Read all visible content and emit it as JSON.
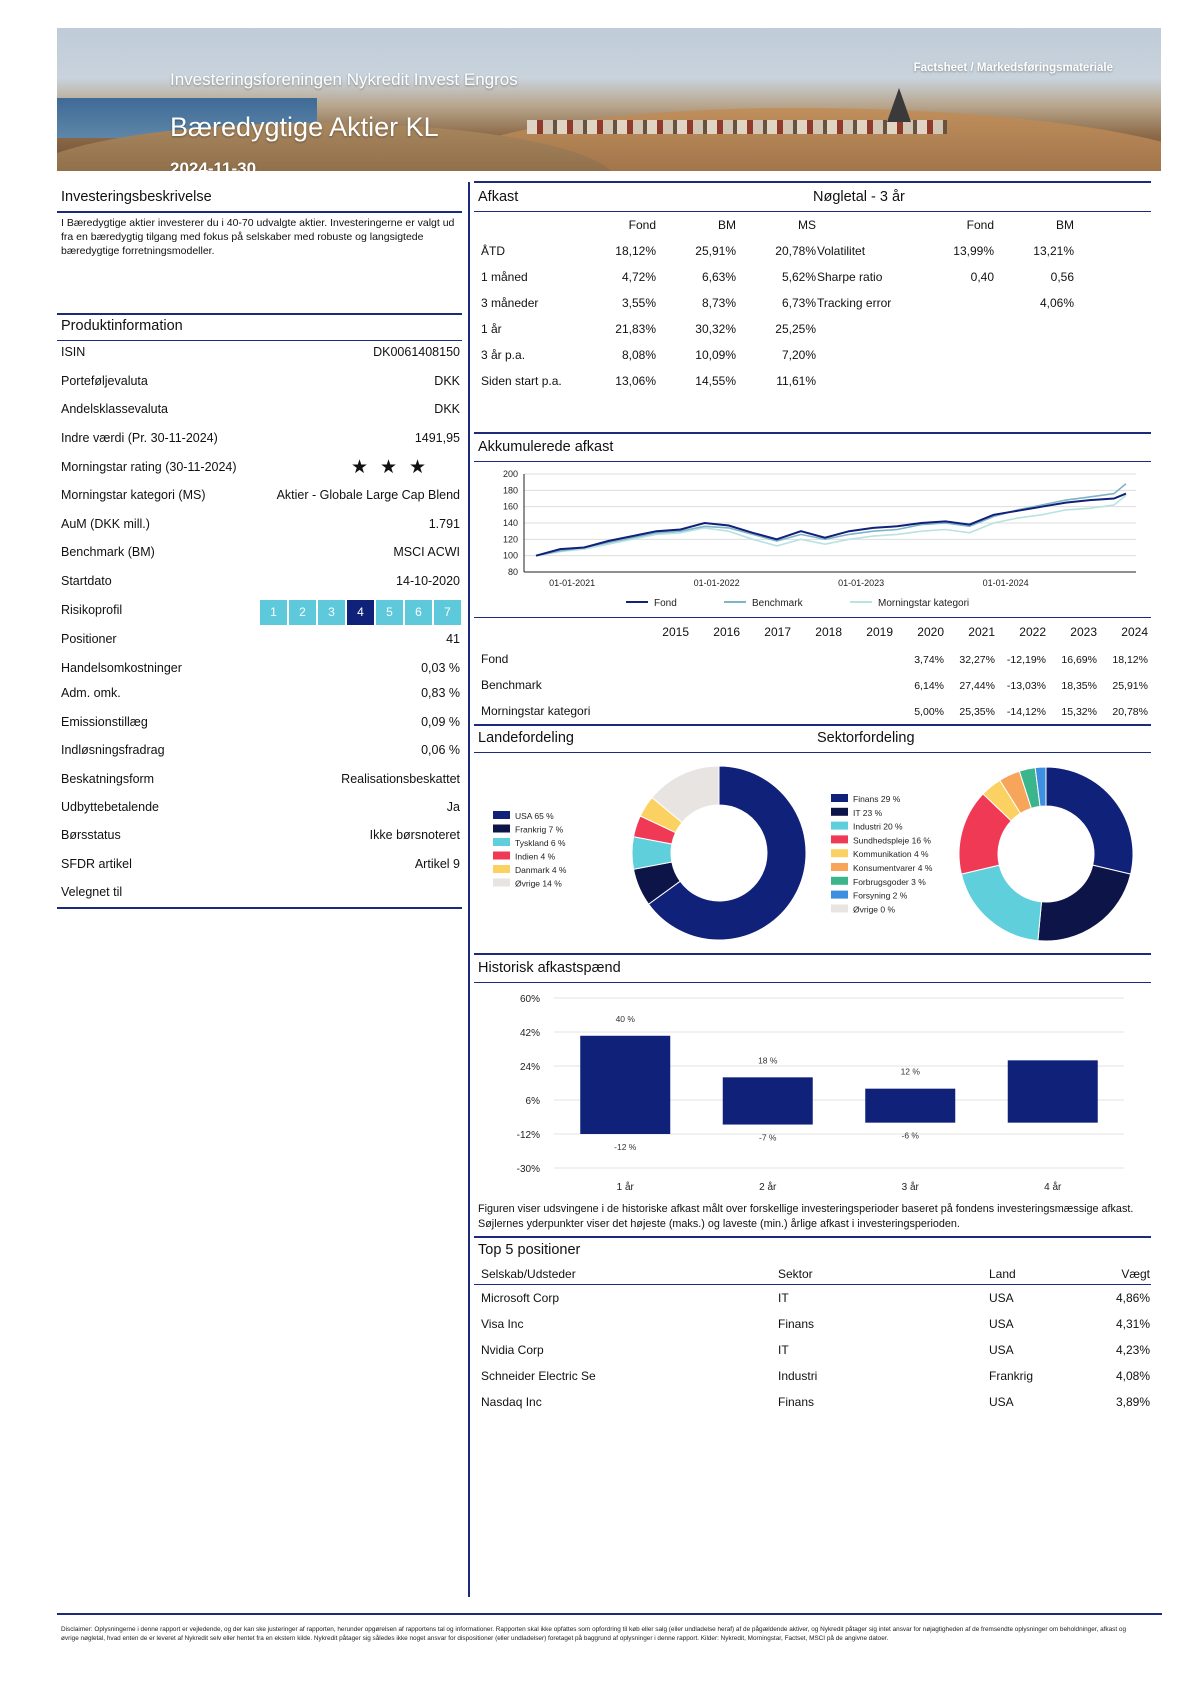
{
  "header": {
    "company": "Investeringsforeningen Nykredit Invest Engros",
    "tag": "Factsheet / Markedsføringsmateriale",
    "fund_name": "Bæredygtige Aktier KL",
    "date": "2024-11-30"
  },
  "description": {
    "title": "Investeringsbeskrivelse",
    "text": "I Bæredygtige aktier investerer du i 40-70 udvalgte aktier. Investeringerne er valgt ud fra en bæredygtig tilgang med fokus på selskaber med robuste og langsigtede bæredygtige forretningsmodeller."
  },
  "product": {
    "title": "Produktinformation",
    "rows": [
      {
        "k": "ISIN",
        "v": "DK0061408150"
      },
      {
        "k": "Porteføljevaluta",
        "v": "DKK"
      },
      {
        "k": "Andelsklassevaluta",
        "v": "DKK"
      },
      {
        "k": "Indre værdi (Pr. 30-11-2024)",
        "v": "1491,95"
      },
      {
        "k": "Morningstar rating (30-11-2024)",
        "v": ""
      },
      {
        "k": "Morningstar kategori (MS)",
        "v": "Aktier - Globale Large Cap Blend"
      },
      {
        "k": "AuM (DKK mill.)",
        "v": "1.791"
      },
      {
        "k": "Benchmark (BM)",
        "v": "MSCI ACWI"
      },
      {
        "k": "Startdato",
        "v": "14-10-2020"
      },
      {
        "k": "Risikoprofil",
        "v": ""
      },
      {
        "k": "Positioner",
        "v": "41"
      },
      {
        "k": "Handelsomkostninger",
        "v": "0,03 %"
      },
      {
        "k": "Adm. omk.",
        "v": "0,83 %"
      },
      {
        "k": "Emissionstillæg",
        "v": "0,09 %"
      },
      {
        "k": "Indløsningsfradrag",
        "v": "0,06 %"
      },
      {
        "k": "Beskatningsform",
        "v": "Realisationsbeskattet"
      },
      {
        "k": "Udbyttebetalende",
        "v": "Ja"
      },
      {
        "k": "Børsstatus",
        "v": "Ikke børsnoteret"
      },
      {
        "k": "SFDR artikel",
        "v": "Artikel 9"
      },
      {
        "k": "Velegnet til",
        "v": ""
      }
    ],
    "morningstar_stars": 3,
    "star_glyph": "★",
    "risk_levels": [
      "1",
      "2",
      "3",
      "4",
      "5",
      "6",
      "7"
    ],
    "risk_selected": 4
  },
  "returns": {
    "title": "Afkast",
    "headers": [
      "Fond",
      "BM",
      "MS"
    ],
    "rows": [
      {
        "label": "ÅTD",
        "vals": [
          "18,12%",
          "25,91%",
          "20,78%"
        ]
      },
      {
        "label": "1 måned",
        "vals": [
          "4,72%",
          "6,63%",
          "5,62%"
        ]
      },
      {
        "label": "3 måneder",
        "vals": [
          "3,55%",
          "8,73%",
          "6,73%"
        ]
      },
      {
        "label": "1 år",
        "vals": [
          "21,83%",
          "30,32%",
          "25,25%"
        ]
      },
      {
        "label": "3 år p.a.",
        "vals": [
          "8,08%",
          "10,09%",
          "7,20%"
        ]
      },
      {
        "label": "Siden start p.a.",
        "vals": [
          "13,06%",
          "14,55%",
          "11,61%"
        ]
      }
    ]
  },
  "keyfigures": {
    "title": "Nøgletal - 3 år",
    "headers": [
      "Fond",
      "BM"
    ],
    "rows": [
      {
        "label": "Volatilitet",
        "vals": [
          "13,99%",
          "13,21%"
        ]
      },
      {
        "label": "Sharpe ratio",
        "vals": [
          "0,40",
          "0,56"
        ]
      },
      {
        "label": "Tracking error",
        "vals": [
          "",
          "4,06%"
        ]
      }
    ]
  },
  "cumulative": {
    "title": "Akkumulerede afkast",
    "colors": {
      "fond": "#10217a",
      "bm": "#7fb3c8",
      "ms": "#b8e3e0"
    }
  },
  "yearly": {
    "years": [
      "2015",
      "2016",
      "2017",
      "2018",
      "2019",
      "2020",
      "2021",
      "2022",
      "2023",
      "2024"
    ],
    "rows": [
      {
        "label": "Fond",
        "vals": [
          "",
          "",
          "",
          "",
          "",
          "3,74%",
          "32,27%",
          "-12,19%",
          "16,69%",
          "18,12%"
        ]
      },
      {
        "label": "Benchmark",
        "vals": [
          "",
          "",
          "",
          "",
          "",
          "6,14%",
          "27,44%",
          "-13,03%",
          "18,35%",
          "25,91%"
        ]
      },
      {
        "label": "Morningstar kategori",
        "vals": [
          "",
          "",
          "",
          "",
          "",
          "5,00%",
          "25,35%",
          "-14,12%",
          "15,32%",
          "20,78%"
        ]
      }
    ]
  },
  "countries": {
    "title": "Landefordeling",
    "items": [
      {
        "label": "USA 65 %",
        "value": 65,
        "color": "#10217a"
      },
      {
        "label": "Frankrig 7 %",
        "value": 7,
        "color": "#0c1448"
      },
      {
        "label": "Tyskland 6 %",
        "value": 6,
        "color": "#5fcfdc"
      },
      {
        "label": "Indien 4 %",
        "value": 4,
        "color": "#f03a55"
      },
      {
        "label": "Danmark 4 %",
        "value": 4,
        "color": "#fbd262"
      },
      {
        "label": "Øvrige 14 %",
        "value": 14,
        "color": "#e8e4e2"
      }
    ]
  },
  "sectors": {
    "title": "Sektorfordeling",
    "items": [
      {
        "label": "Finans 29 %",
        "value": 29,
        "color": "#10217a"
      },
      {
        "label": "IT 23 %",
        "value": 23,
        "color": "#0c1448"
      },
      {
        "label": "Industri 20 %",
        "value": 20,
        "color": "#5fcfdc"
      },
      {
        "label": "Sundhedspleje 16 %",
        "value": 16,
        "color": "#f03a55"
      },
      {
        "label": "Kommunikation 4 %",
        "value": 4,
        "color": "#fbd262"
      },
      {
        "label": "Konsumentvarer 4 %",
        "value": 4,
        "color": "#f6a55a"
      },
      {
        "label": "Forbrugsgoder 3 %",
        "value": 3,
        "color": "#3bb58c"
      },
      {
        "label": "Forsyning 2 %",
        "value": 2,
        "color": "#3f8fe0"
      },
      {
        "label": "Øvrige 0 %",
        "value": 0,
        "color": "#e8e4e2"
      }
    ]
  },
  "historic": {
    "title": "Historisk afkastspænd",
    "caption": "Figuren viser udsvingene i de historiske afkast målt over forskellige investeringsperioder baseret på fondens investeringsmæssige afkast. Søjlernes yderpunkter viser det højeste (maks.) og laveste (min.) årlige afkast i investeringsperioden."
  },
  "top5": {
    "title": "Top 5 positioner",
    "headers": [
      "Selskab/Udsteder",
      "Sektor",
      "Land",
      "Vægt"
    ],
    "rows": [
      [
        "Microsoft Corp",
        "IT",
        "USA",
        "4,86%"
      ],
      [
        "Visa Inc",
        "Finans",
        "USA",
        "4,31%"
      ],
      [
        "Nvidia Corp",
        "IT",
        "USA",
        "4,23%"
      ],
      [
        "Schneider Electric Se",
        "Industri",
        "Frankrig",
        "4,08%"
      ],
      [
        "Nasdaq Inc",
        "Finans",
        "USA",
        "3,89%"
      ]
    ]
  },
  "disclaimer": "Disclaimer: Oplysningerne i denne rapport er vejledende, og der kan ske justeringer af rapporten, herunder opgørelsen af rapportens tal og informationer. Rapporten skal ikke opfattes som opfordring til køb eller salg (eller undladelse heraf) af de pågældende aktiver, og Nykredit påtager sig intet ansvar for nøjagtigheden af de fremsendte oplysninger om beholdninger, afkast og øvrige nøgletal, hvad enten de er leveret af Nykredit selv eller hentet fra en ekstern kilde. Nykredit påtager sig således ikke noget ansvar for dispositioner (eller undladelser) foretaget på baggrund af oplysninger i denne rapport. Kilder: Nykredit, Morningstar, Factset, MSCI på de angivne datoer.",
  "chart_data": [
    {
      "type": "line",
      "title": "Akkumulerede afkast",
      "x_ticks": [
        "01-01-2021",
        "01-01-2022",
        "01-01-2023",
        "01-01-2024"
      ],
      "ylim": [
        80,
        200
      ],
      "y_ticks": [
        80,
        100,
        120,
        140,
        160,
        180,
        200
      ],
      "x": [
        "2020-10",
        "2020-12",
        "2021-02",
        "2021-04",
        "2021-06",
        "2021-08",
        "2021-10",
        "2021-12",
        "2022-02",
        "2022-04",
        "2022-06",
        "2022-08",
        "2022-10",
        "2022-12",
        "2023-02",
        "2023-04",
        "2023-06",
        "2023-08",
        "2023-10",
        "2023-12",
        "2024-02",
        "2024-04",
        "2024-06",
        "2024-08",
        "2024-10",
        "2024-11"
      ],
      "series": [
        {
          "name": "Fond",
          "values": [
            100,
            108,
            110,
            118,
            124,
            130,
            132,
            140,
            137,
            128,
            120,
            130,
            122,
            130,
            134,
            136,
            140,
            142,
            138,
            150,
            155,
            160,
            165,
            168,
            170,
            176
          ]
        },
        {
          "name": "Benchmark",
          "values": [
            100,
            106,
            110,
            116,
            122,
            128,
            130,
            136,
            134,
            126,
            118,
            126,
            120,
            126,
            130,
            132,
            138,
            140,
            136,
            148,
            156,
            162,
            168,
            172,
            176,
            188
          ]
        },
        {
          "name": "Morningstar kategori",
          "values": [
            100,
            105,
            108,
            114,
            120,
            126,
            128,
            134,
            130,
            120,
            112,
            120,
            114,
            120,
            124,
            126,
            130,
            132,
            128,
            140,
            146,
            150,
            156,
            158,
            162,
            174
          ]
        }
      ],
      "legend": "bottom"
    },
    {
      "type": "pie",
      "title": "Landefordeling",
      "categories": [
        "USA",
        "Frankrig",
        "Tyskland",
        "Indien",
        "Danmark",
        "Øvrige"
      ],
      "values": [
        65,
        7,
        6,
        4,
        4,
        14
      ]
    },
    {
      "type": "pie",
      "title": "Sektorfordeling",
      "categories": [
        "Finans",
        "IT",
        "Industri",
        "Sundhedspleje",
        "Kommunikation",
        "Konsumentvarer",
        "Forbrugsgoder",
        "Forsyning",
        "Øvrige"
      ],
      "values": [
        29,
        23,
        20,
        16,
        4,
        4,
        3,
        2,
        0
      ]
    },
    {
      "type": "bar",
      "title": "Historisk afkastspænd",
      "categories": [
        "1 år",
        "2 år",
        "3 år",
        "4 år"
      ],
      "y_ticks": [
        "60%",
        "42%",
        "24%",
        "6%",
        "-12%",
        "-30%"
      ],
      "ylim": [
        -30,
        60
      ],
      "series": [
        {
          "name": "max",
          "values": [
            40,
            18,
            12,
            27
          ]
        },
        {
          "name": "min",
          "values": [
            -12,
            -7,
            -6,
            -6
          ]
        }
      ],
      "max_labels": [
        "40 %",
        "18 %",
        "12 %",
        ""
      ],
      "min_labels": [
        "-12 %",
        "-7 %",
        "-6 %",
        ""
      ]
    }
  ]
}
